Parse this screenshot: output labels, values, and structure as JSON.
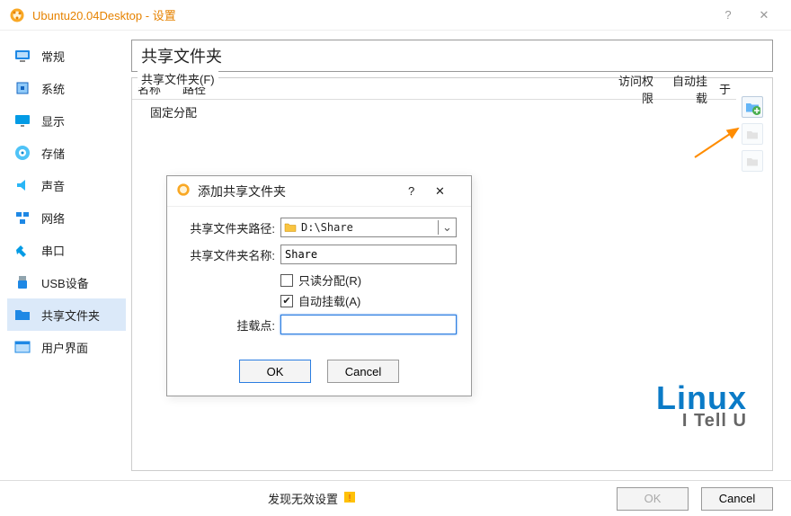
{
  "window": {
    "title": "Ubuntu20.04Desktop - 设置"
  },
  "sidebar": {
    "items": [
      {
        "label": "常规"
      },
      {
        "label": "系统"
      },
      {
        "label": "显示"
      },
      {
        "label": "存储"
      },
      {
        "label": "声音"
      },
      {
        "label": "网络"
      },
      {
        "label": "串口"
      },
      {
        "label": "USB设备"
      },
      {
        "label": "共享文件夹"
      },
      {
        "label": "用户界面"
      }
    ]
  },
  "content": {
    "header": "共享文件夹",
    "group_label": "共享文件夹(F)",
    "columns": {
      "name": "名称",
      "path": "路径",
      "perm": "访问权限",
      "automount": "自动挂载",
      "at": "于"
    },
    "fixed_row": "固定分配"
  },
  "dialog": {
    "title": "添加共享文件夹",
    "help_glyph": "?",
    "close_glyph": "✕",
    "path_label": "共享文件夹路径:",
    "path_value": "D:\\Share",
    "name_label": "共享文件夹名称:",
    "name_value": "Share",
    "readonly_label": "只读分配(R)",
    "automount_label": "自动挂载(A)",
    "mountpoint_label": "挂载点:",
    "mountpoint_value": "",
    "ok_label": "OK",
    "cancel_label": "Cancel",
    "readonly_checked": false,
    "automount_checked": true
  },
  "footer": {
    "status": "发现无效设置",
    "ok_label": "OK",
    "cancel_label": "Cancel"
  },
  "watermark": {
    "big": "Linux",
    "small": "I Tell U"
  }
}
